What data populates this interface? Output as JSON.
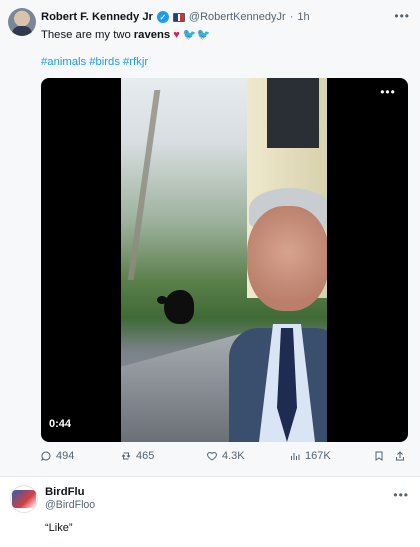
{
  "post": {
    "author_name": "Robert F. Kennedy Jr",
    "handle": "@RobertKennedyJr",
    "time": "1h",
    "text_before": "These are my two",
    "text_bold": "ravens",
    "emoji_heart": "♥",
    "emoji_birds": "🐦🐦",
    "hashtags": [
      "#animals",
      "#birds",
      "#rfkjr"
    ],
    "video": {
      "duration": "0:44"
    },
    "actions": {
      "replies": "494",
      "reposts": "465",
      "likes": "4.3K",
      "views": "167K"
    }
  },
  "reply": {
    "author_name": "BirdFlu",
    "handle": "@BirdFloo",
    "text": "“Like”"
  },
  "colors": {
    "accent": "#1d9bf0",
    "text": "#0f1419",
    "muted": "#536471",
    "heart": "#d0245e"
  }
}
